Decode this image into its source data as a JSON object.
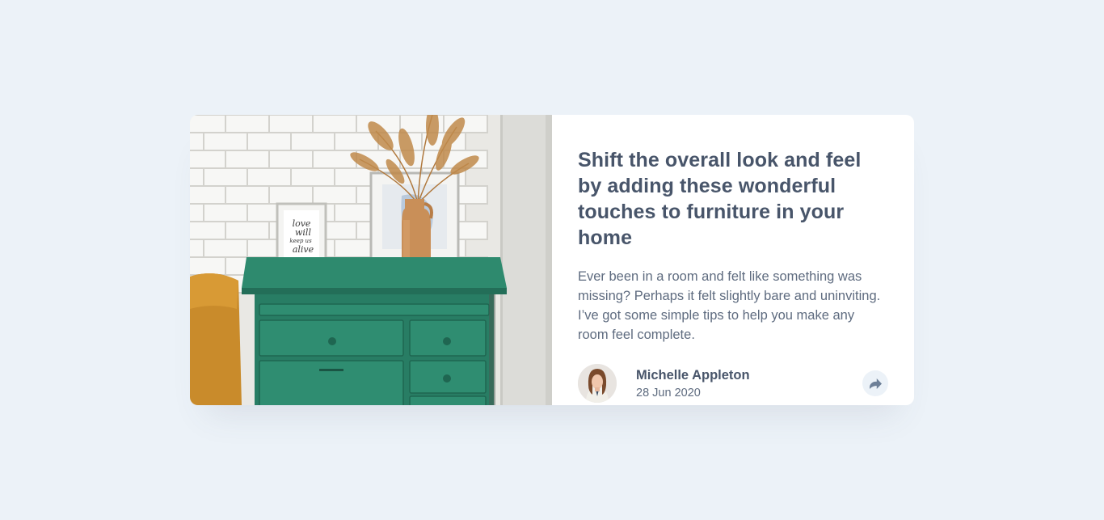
{
  "card": {
    "image_alt": "Green drawers with vase and picture frames",
    "frame_text": [
      "love",
      "will",
      "keep us",
      "alive"
    ],
    "title": "Shift the overall look and feel by adding these wonderful touches to furniture in your home",
    "description": "Ever been in a room and felt like something was missing? Perhaps it felt slightly bare and uninviting. I’ve got some simple tips to help you make any room feel complete.",
    "author": {
      "name": "Michelle Appleton",
      "date": "28 Jun 2020"
    },
    "share_icon": "share-icon"
  },
  "colors": {
    "background": "#ecf2f8",
    "card": "#ffffff",
    "heading": "#48556a",
    "body": "#5e6b7f",
    "drawer_green": "#2b8268"
  }
}
